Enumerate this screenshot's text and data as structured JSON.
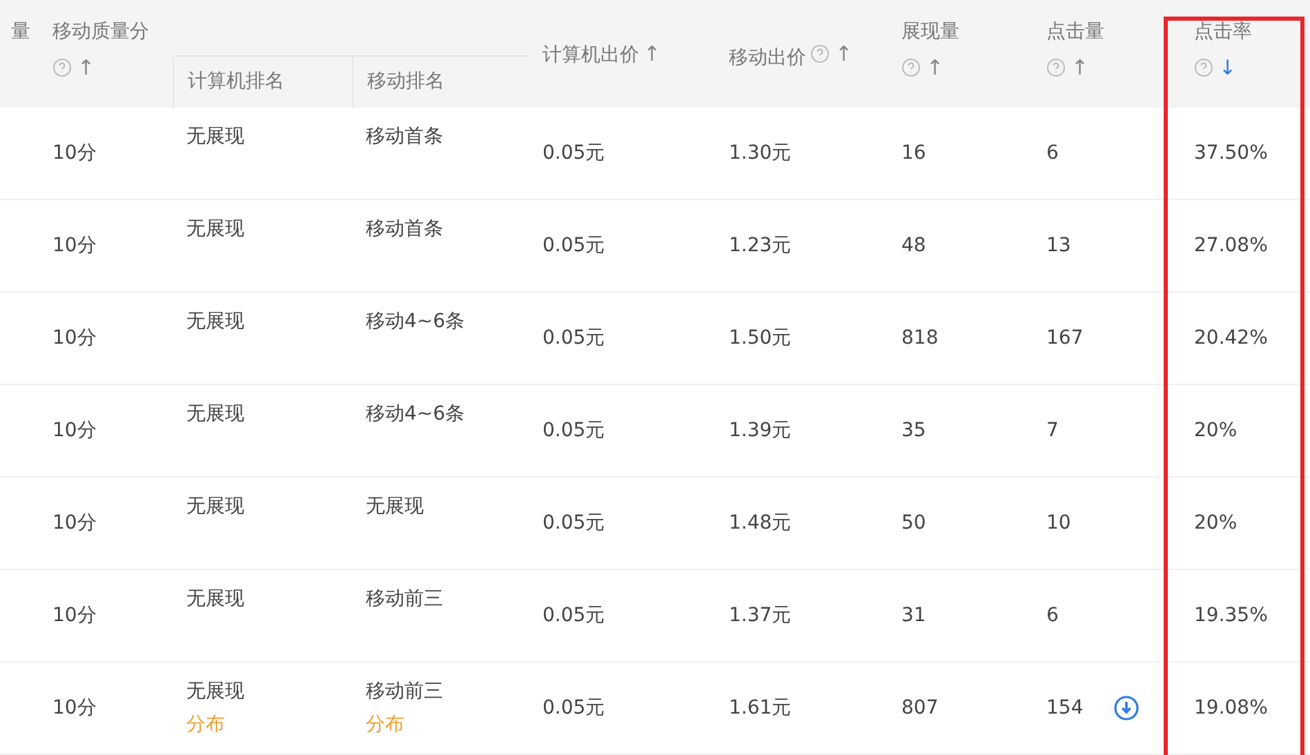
{
  "columns": [
    {
      "label": "量",
      "kind": "plain"
    },
    {
      "label": "移动质量分",
      "help": true,
      "arrow": "↑",
      "sorted": false,
      "kind": "stacked"
    },
    {
      "label": "计算机排名",
      "kind": "sub"
    },
    {
      "label": "移动排名",
      "kind": "sub"
    },
    {
      "label": "计算机出价",
      "arrow": "↑",
      "sorted": false,
      "kind": "inline"
    },
    {
      "label": "移动出价",
      "help": true,
      "arrow": "↑",
      "sorted": false,
      "kind": "inline"
    },
    {
      "label": "展现量",
      "help": true,
      "arrow": "↑",
      "sorted": false,
      "kind": "stacked"
    },
    {
      "label": "点击量",
      "help": true,
      "arrow": "↑",
      "sorted": false,
      "kind": "stacked"
    },
    {
      "label": "点击率",
      "help": true,
      "arrow": "↓",
      "sorted": true,
      "kind": "stacked",
      "highlighted": true
    }
  ],
  "rows": [
    {
      "quality": "10分",
      "pc_rank": {
        "text": "无展现"
      },
      "mobile_rank": {
        "text": "移动首条"
      },
      "pc_bid": "0.05元",
      "mobile_bid": "1.30元",
      "impressions": "16",
      "clicks": "6",
      "download": false,
      "ctr": "37.50%"
    },
    {
      "quality": "10分",
      "pc_rank": {
        "text": "无展现"
      },
      "mobile_rank": {
        "text": "移动首条"
      },
      "pc_bid": "0.05元",
      "mobile_bid": "1.23元",
      "impressions": "48",
      "clicks": "13",
      "download": false,
      "ctr": "27.08%"
    },
    {
      "quality": "10分",
      "pc_rank": {
        "text": "无展现"
      },
      "mobile_rank": {
        "text": "移动4~6条"
      },
      "pc_bid": "0.05元",
      "mobile_bid": "1.50元",
      "impressions": "818",
      "clicks": "167",
      "download": false,
      "ctr": "20.42%"
    },
    {
      "quality": "10分",
      "pc_rank": {
        "text": "无展现"
      },
      "mobile_rank": {
        "text": "移动4~6条"
      },
      "pc_bid": "0.05元",
      "mobile_bid": "1.39元",
      "impressions": "35",
      "clicks": "7",
      "download": false,
      "ctr": "20%"
    },
    {
      "quality": "10分",
      "pc_rank": {
        "text": "无展现"
      },
      "mobile_rank": {
        "text": "无展现"
      },
      "pc_bid": "0.05元",
      "mobile_bid": "1.48元",
      "impressions": "50",
      "clicks": "10",
      "download": false,
      "ctr": "20%"
    },
    {
      "quality": "10分",
      "pc_rank": {
        "text": "无展现"
      },
      "mobile_rank": {
        "text": "移动前三"
      },
      "pc_bid": "0.05元",
      "mobile_bid": "1.37元",
      "impressions": "31",
      "clicks": "6",
      "download": false,
      "ctr": "19.35%"
    },
    {
      "quality": "10分",
      "pc_rank": {
        "text": "无展现",
        "link": "分布"
      },
      "mobile_rank": {
        "text": "移动前三",
        "link": "分布"
      },
      "pc_bid": "0.05元",
      "mobile_bid": "1.61元",
      "impressions": "807",
      "clicks": "154",
      "download": true,
      "ctr": "19.08%"
    }
  ]
}
